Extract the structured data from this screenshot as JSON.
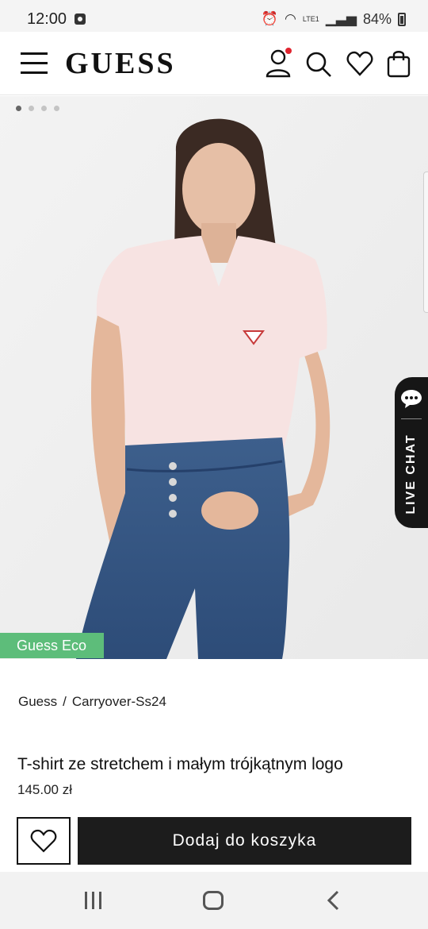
{
  "status_bar": {
    "time": "12:00",
    "battery": "84%",
    "network": "LTE1"
  },
  "header": {
    "logo": "GUESS",
    "icons": [
      "menu-icon",
      "account-icon",
      "search-icon",
      "heart-icon",
      "shopping-bag-icon"
    ],
    "notification_dot_color": "#e0242f"
  },
  "gallery": {
    "dot_count": 4,
    "active_index": 0,
    "badge": "Guess Eco",
    "badge_color": "#5dbd7a"
  },
  "live_chat": {
    "label": "LIVE CHAT"
  },
  "breadcrumb": {
    "items": [
      "Guess",
      "Carryover-Ss24"
    ],
    "separator": "/"
  },
  "product": {
    "title": "T-shirt ze stretchem i małym trójkątnym logo",
    "price": "145.00 zł"
  },
  "actions": {
    "add_to_cart": "Dodaj do koszyka"
  },
  "colors": {
    "primary": "#1c1c1c",
    "accent": "#e0242f"
  }
}
